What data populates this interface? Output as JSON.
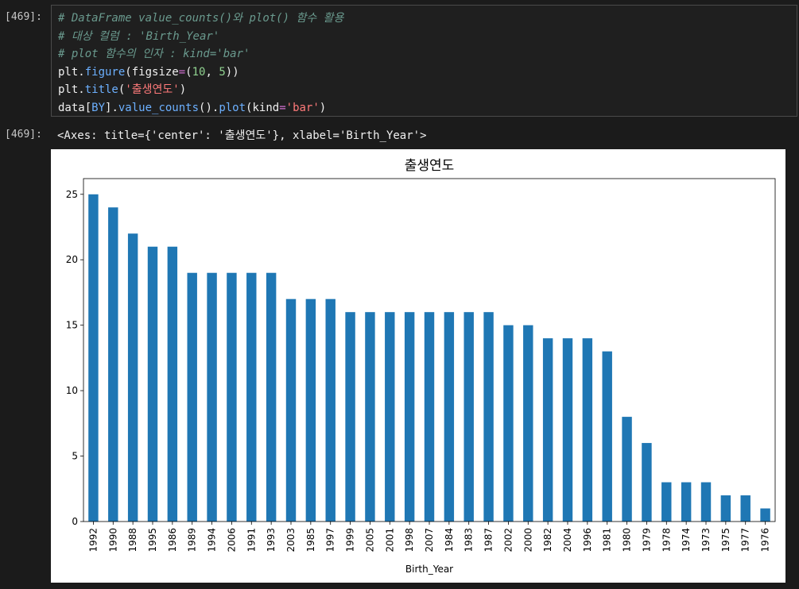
{
  "input_cell": {
    "prompt": "[469]:",
    "lines": [
      [
        {
          "t": "# DataFrame value_counts()와 plot() 함수 활용",
          "c": "cm"
        }
      ],
      [
        {
          "t": "# 대상 컬럼 : 'Birth_Year'",
          "c": "cm"
        }
      ],
      [
        {
          "t": "# plot 함수의 인자 : kind='bar'",
          "c": "cm"
        }
      ],
      [
        {
          "t": "plt.",
          "c": "pl"
        },
        {
          "t": "figure",
          "c": "fn"
        },
        {
          "t": "(figsize",
          "c": "pl"
        },
        {
          "t": "=",
          "c": "op"
        },
        {
          "t": "(",
          "c": "pl"
        },
        {
          "t": "10",
          "c": "nm"
        },
        {
          "t": ", ",
          "c": "pl"
        },
        {
          "t": "5",
          "c": "nm"
        },
        {
          "t": "))",
          "c": "pl"
        }
      ],
      [
        {
          "t": "plt.",
          "c": "pl"
        },
        {
          "t": "title",
          "c": "fn"
        },
        {
          "t": "(",
          "c": "pl"
        },
        {
          "t": "'출생연도'",
          "c": "st"
        },
        {
          "t": ")",
          "c": "pl"
        }
      ],
      [
        {
          "t": "data[",
          "c": "pl"
        },
        {
          "t": "BY",
          "c": "fn"
        },
        {
          "t": "].",
          "c": "pl"
        },
        {
          "t": "value_counts",
          "c": "fn"
        },
        {
          "t": "().",
          "c": "pl"
        },
        {
          "t": "plot",
          "c": "fn"
        },
        {
          "t": "(kind",
          "c": "pl"
        },
        {
          "t": "=",
          "c": "op"
        },
        {
          "t": "'bar'",
          "c": "st"
        },
        {
          "t": ")",
          "c": "pl"
        }
      ]
    ]
  },
  "output_cell": {
    "prompt": "[469]:",
    "text": "<Axes: title={'center': '출생연도'}, xlabel='Birth_Year'>"
  },
  "colors": {
    "bar": "#1f77b4"
  },
  "chart_data": {
    "type": "bar",
    "title": "출생연도",
    "xlabel": "Birth_Year",
    "ylabel": "",
    "ylim": [
      0,
      26.2
    ],
    "yticks": [
      0,
      5,
      10,
      15,
      20,
      25
    ],
    "grid": false,
    "categories": [
      "1992",
      "1990",
      "1988",
      "1995",
      "1986",
      "1989",
      "1994",
      "2006",
      "1991",
      "1993",
      "2003",
      "1985",
      "1997",
      "1999",
      "2005",
      "2001",
      "1998",
      "2007",
      "1984",
      "1983",
      "1987",
      "2002",
      "2000",
      "1982",
      "2004",
      "1996",
      "1981",
      "1980",
      "1979",
      "1978",
      "1974",
      "1973",
      "1975",
      "1977",
      "1976"
    ],
    "values": [
      25,
      24,
      22,
      21,
      21,
      19,
      19,
      19,
      19,
      19,
      17,
      17,
      17,
      16,
      16,
      16,
      16,
      16,
      16,
      16,
      16,
      15,
      15,
      14,
      14,
      14,
      13,
      8,
      6,
      3,
      3,
      3,
      2,
      2,
      1
    ]
  }
}
